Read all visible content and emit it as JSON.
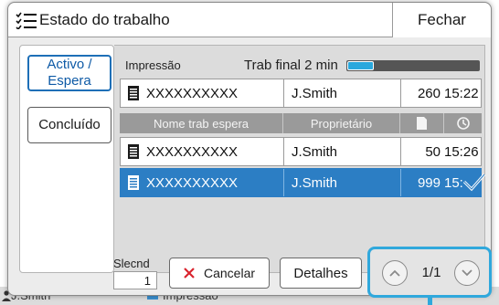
{
  "background": {
    "user": "J.Smith",
    "job_status": "Impressão"
  },
  "dialog": {
    "title": "Estado do trabalho",
    "close_label": "Fechar"
  },
  "tabs": [
    {
      "label_line1": "Activo /",
      "label_line2": "Espera",
      "active": true
    },
    {
      "label": "Concluído",
      "active": false
    }
  ],
  "current_job": {
    "section_label": "Impressão",
    "status_text": "Trab final 2 min",
    "progress_fraction": 0.2,
    "name": "XXXXXXXXXX",
    "owner": "J.Smith",
    "pages": "260",
    "time": "15:22"
  },
  "list": {
    "headers": {
      "name": "Nome trab espera",
      "owner": "Proprietário",
      "pages_icon": "document-icon",
      "time_icon": "clock-icon"
    },
    "rows": [
      {
        "name": "XXXXXXXXXX",
        "owner": "J.Smith",
        "pages": "50",
        "time": "15:26",
        "selected": false
      },
      {
        "name": "XXXXXXXXXX",
        "owner": "J.Smith",
        "pages": "999",
        "time": "15:",
        "selected": true
      }
    ]
  },
  "controls": {
    "selected_label": "Slecnd",
    "selected_count": "1",
    "cancel_label": "Cancelar",
    "details_label": "Detalhes",
    "page_indicator": "1/1"
  },
  "colors": {
    "accent": "#2c7ec4",
    "highlight": "#30a8dc",
    "cancel_x": "#d9232d"
  }
}
